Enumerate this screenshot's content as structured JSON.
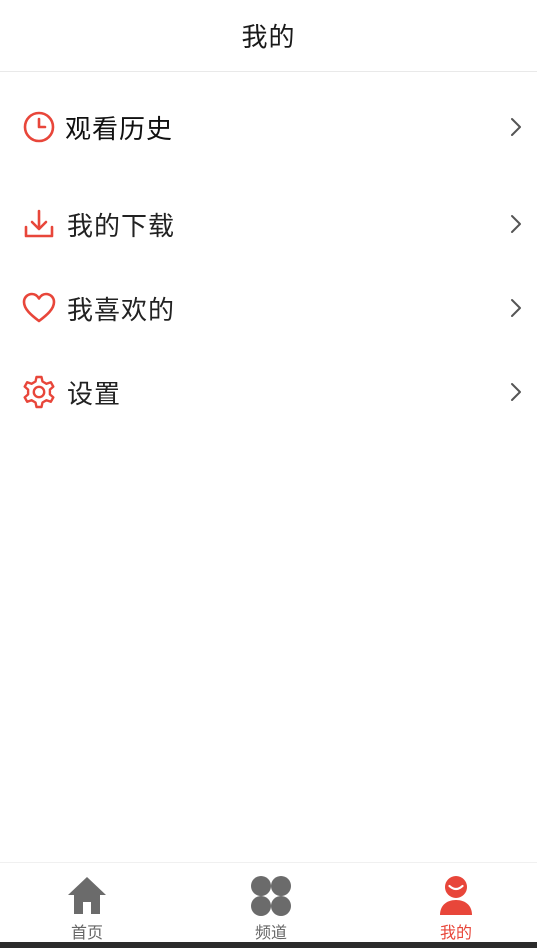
{
  "header": {
    "title": "我的"
  },
  "menu": [
    {
      "label": "观看历史",
      "icon": "clock-icon"
    },
    {
      "label": "我的下载",
      "icon": "download-icon"
    },
    {
      "label": "我喜欢的",
      "icon": "heart-icon"
    },
    {
      "label": "设置",
      "icon": "gear-icon"
    }
  ],
  "tabs": [
    {
      "label": "首页",
      "icon": "home-icon",
      "active": false
    },
    {
      "label": "频道",
      "icon": "channels-icon",
      "active": false
    },
    {
      "label": "我的",
      "icon": "user-icon",
      "active": true
    }
  ],
  "colors": {
    "accent": "#e8463a",
    "icon_gray": "#6b6b6b",
    "chevron": "#555555"
  }
}
